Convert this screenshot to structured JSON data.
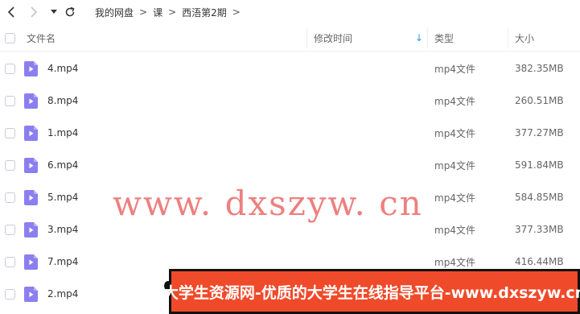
{
  "breadcrumb": {
    "items": [
      "我的网盘",
      "课",
      "西浯第2期"
    ],
    "separator": ">"
  },
  "table": {
    "headers": {
      "name": "文件名",
      "modified": "修改时间",
      "type": "类型",
      "size": "大小"
    },
    "sort_indicator": "↓",
    "rows": [
      {
        "name": "4.mp4",
        "type": "mp4文件",
        "size": "382.35MB"
      },
      {
        "name": "8.mp4",
        "type": "mp4文件",
        "size": "260.51MB"
      },
      {
        "name": "1.mp4",
        "type": "mp4文件",
        "size": "377.27MB"
      },
      {
        "name": "6.mp4",
        "type": "mp4文件",
        "size": "591.84MB"
      },
      {
        "name": "5.mp4",
        "type": "mp4文件",
        "size": "584.85MB"
      },
      {
        "name": "3.mp4",
        "type": "mp4文件",
        "size": "377.33MB"
      },
      {
        "name": "7.mp4",
        "type": "mp4文件",
        "size": "416.44MB"
      },
      {
        "name": "2.mp4",
        "type": "",
        "size": ""
      }
    ]
  },
  "watermark": "www. dxszyw. cn",
  "banner": "大学生资源网-优质的大学生在线指导平台-www.dxszyw.cn",
  "colors": {
    "file_icon": "#8b7ff0",
    "sort_arrow": "#2f9be8",
    "banner_bg": "#ef4a2a",
    "watermark": "#e85c5c"
  }
}
